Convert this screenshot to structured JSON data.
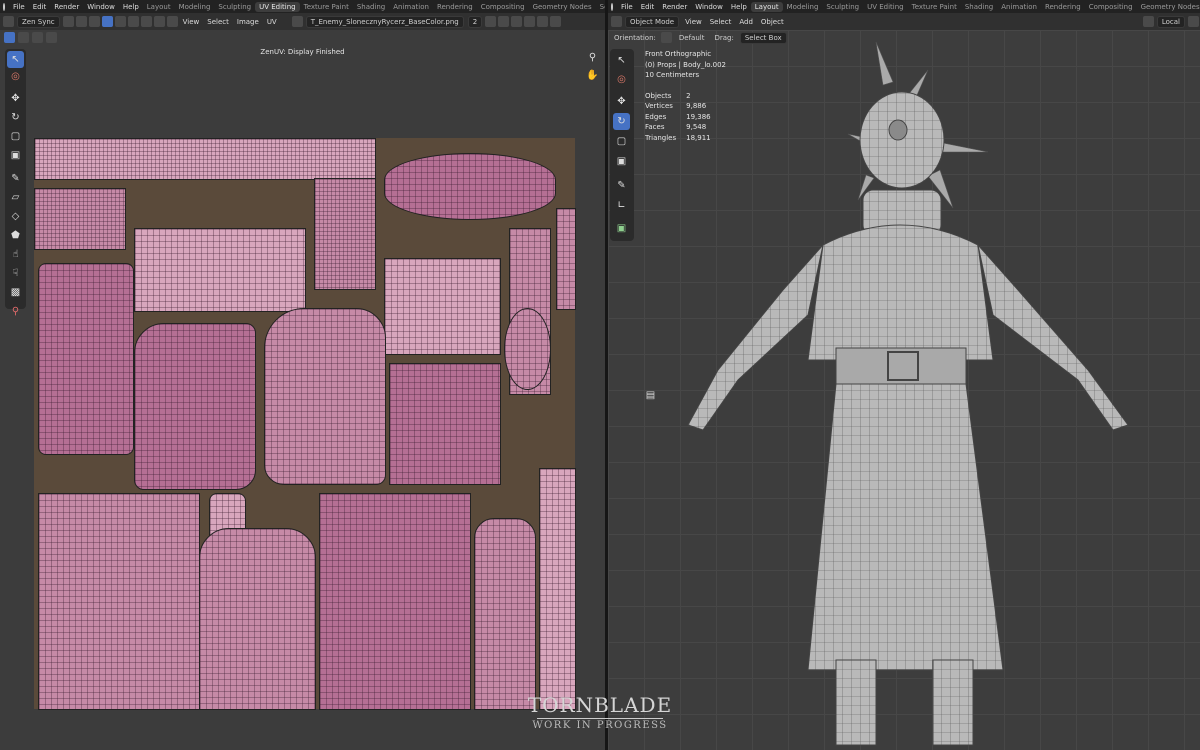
{
  "left": {
    "menus": [
      "File",
      "Edit",
      "Render",
      "Window",
      "Help"
    ],
    "workspaces": [
      "Layout",
      "Modeling",
      "Sculpting",
      "UV Editing",
      "Texture Paint",
      "Shading",
      "Animation",
      "Rendering",
      "Compositing",
      "Geometry Nodes",
      "Scripting"
    ],
    "active_workspace": "UV Editing",
    "header": {
      "sync_label": "Zen Sync",
      "view_menu": "View",
      "select_menu": "Select",
      "image_menu": "Image",
      "uv_menu": "UV",
      "image_name": "T_Enemy_SlonecznyRycerz_BaseColor.png",
      "user_count": "2"
    },
    "status_text": "ZenUV: Display Finished"
  },
  "right": {
    "menus": [
      "File",
      "Edit",
      "Render",
      "Window",
      "Help"
    ],
    "workspaces": [
      "Layout",
      "Modeling",
      "Sculpting",
      "UV Editing",
      "Texture Paint",
      "Shading",
      "Animation",
      "Rendering",
      "Compositing",
      "Geometry Nodes"
    ],
    "active_workspace": "Layout",
    "header": {
      "mode": "Object Mode",
      "view_menu": "View",
      "select_menu": "Select",
      "add_menu": "Add",
      "object_menu": "Object",
      "transform_orientation": "Local"
    },
    "subheader": {
      "orientation_label": "Orientation:",
      "orientation_value": "Default",
      "drag_label": "Drag:",
      "drag_value": "Select Box"
    },
    "viewport_info": {
      "view_name": "Front Orthographic",
      "collection": "(0) Props | Body_lo.002",
      "scale": "10 Centimeters"
    },
    "stats": [
      {
        "label": "Objects",
        "value": "2"
      },
      {
        "label": "Vertices",
        "value": "9,886"
      },
      {
        "label": "Edges",
        "value": "19,386"
      },
      {
        "label": "Faces",
        "value": "9,548"
      },
      {
        "label": "Triangles",
        "value": "18,911"
      }
    ]
  },
  "watermark": {
    "title": "TORNBLADE",
    "subtitle": "WORK IN PROGRESS"
  },
  "colors": {
    "accent": "#4672c4",
    "uv_island": "#c68aa7",
    "background": "#3c3c3c"
  }
}
